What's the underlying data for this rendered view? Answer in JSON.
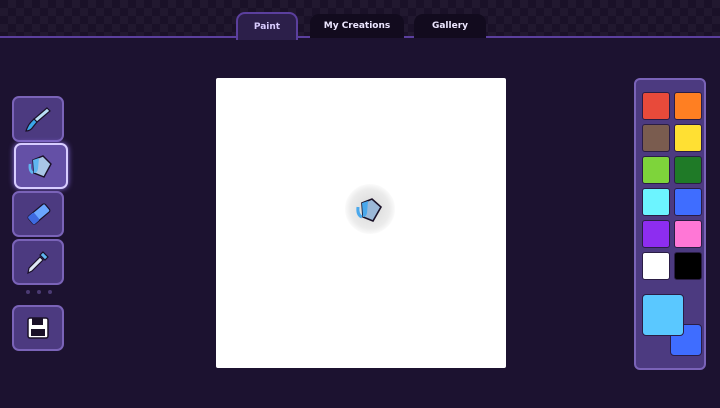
{
  "tabs": [
    {
      "label": "Paint",
      "active": true
    },
    {
      "label": "My Creations",
      "active": false
    },
    {
      "label": "Gallery",
      "active": false
    }
  ],
  "tools": [
    {
      "name": "brush-tool",
      "icon": "paintbrush-icon",
      "active": false
    },
    {
      "name": "fill-tool",
      "icon": "paint-bucket-icon",
      "active": true
    },
    {
      "name": "eraser-tool",
      "icon": "eraser-icon",
      "active": false
    },
    {
      "name": "eyedropper-tool",
      "icon": "eyedropper-icon",
      "active": false
    },
    {
      "name": "save-button",
      "icon": "save-icon",
      "active": false
    }
  ],
  "canvas": {
    "background": "#ffffff",
    "cursor_icon": "paint-bucket-icon"
  },
  "palette": {
    "swatches": [
      "#e84a3a",
      "#ff7f22",
      "#7a5c4f",
      "#ffe033",
      "#7ed43b",
      "#1f7a27",
      "#6cf4ff",
      "#3f6dff",
      "#8d2df0",
      "#ff77d6",
      "#ffffff",
      "#000000"
    ],
    "primary_color": "#5ac8ff",
    "secondary_color": "#3f6dff"
  }
}
